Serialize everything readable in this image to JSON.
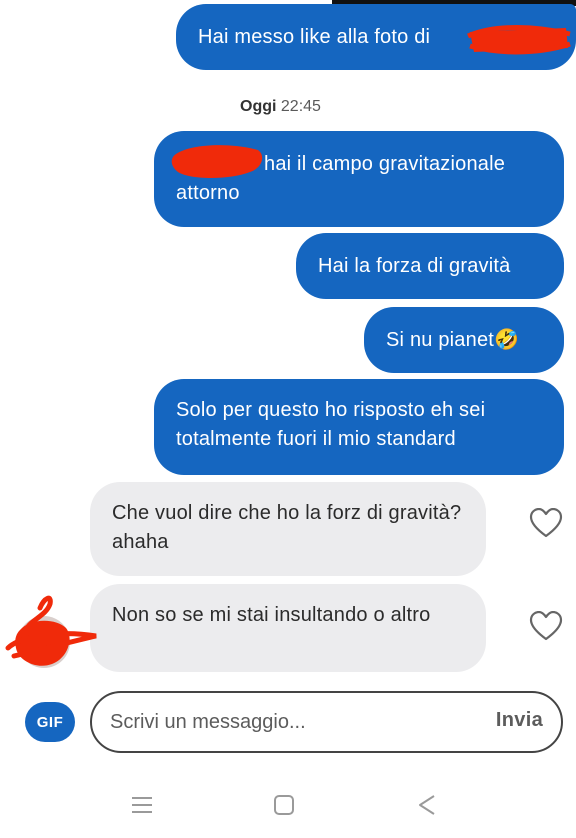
{
  "messages": [
    {
      "direction": "outgoing",
      "text": "Hai messo like alla foto di"
    },
    {
      "direction": "outgoing",
      "text": "hai il campo gravitazionale attorno"
    },
    {
      "direction": "outgoing",
      "text": "Hai la forza di gravità"
    },
    {
      "direction": "outgoing",
      "text": "Si nu pianet🤣"
    },
    {
      "direction": "outgoing",
      "text": "Solo per questo ho risposto eh sei totalmente fuori il mio standard"
    },
    {
      "direction": "incoming",
      "text": "Che vuol dire che ho la forz di gravità?ahaha"
    },
    {
      "direction": "incoming",
      "text": "Non so se mi stai insultando o altro"
    }
  ],
  "timestamp": {
    "day": "Oggi",
    "time": "22:45"
  },
  "composer": {
    "gif_label": "GIF",
    "placeholder": "Scrivi un messaggio...",
    "send_label": "Invia"
  },
  "icons": {
    "like": "heart-outline-icon",
    "nav_recents": "menu-lines-icon",
    "nav_home": "square-icon",
    "nav_back": "triangle-back-icon"
  },
  "colors": {
    "outgoing_bubble": "#1566c0",
    "incoming_bubble": "#ececee",
    "redaction": "#f02a0a"
  }
}
